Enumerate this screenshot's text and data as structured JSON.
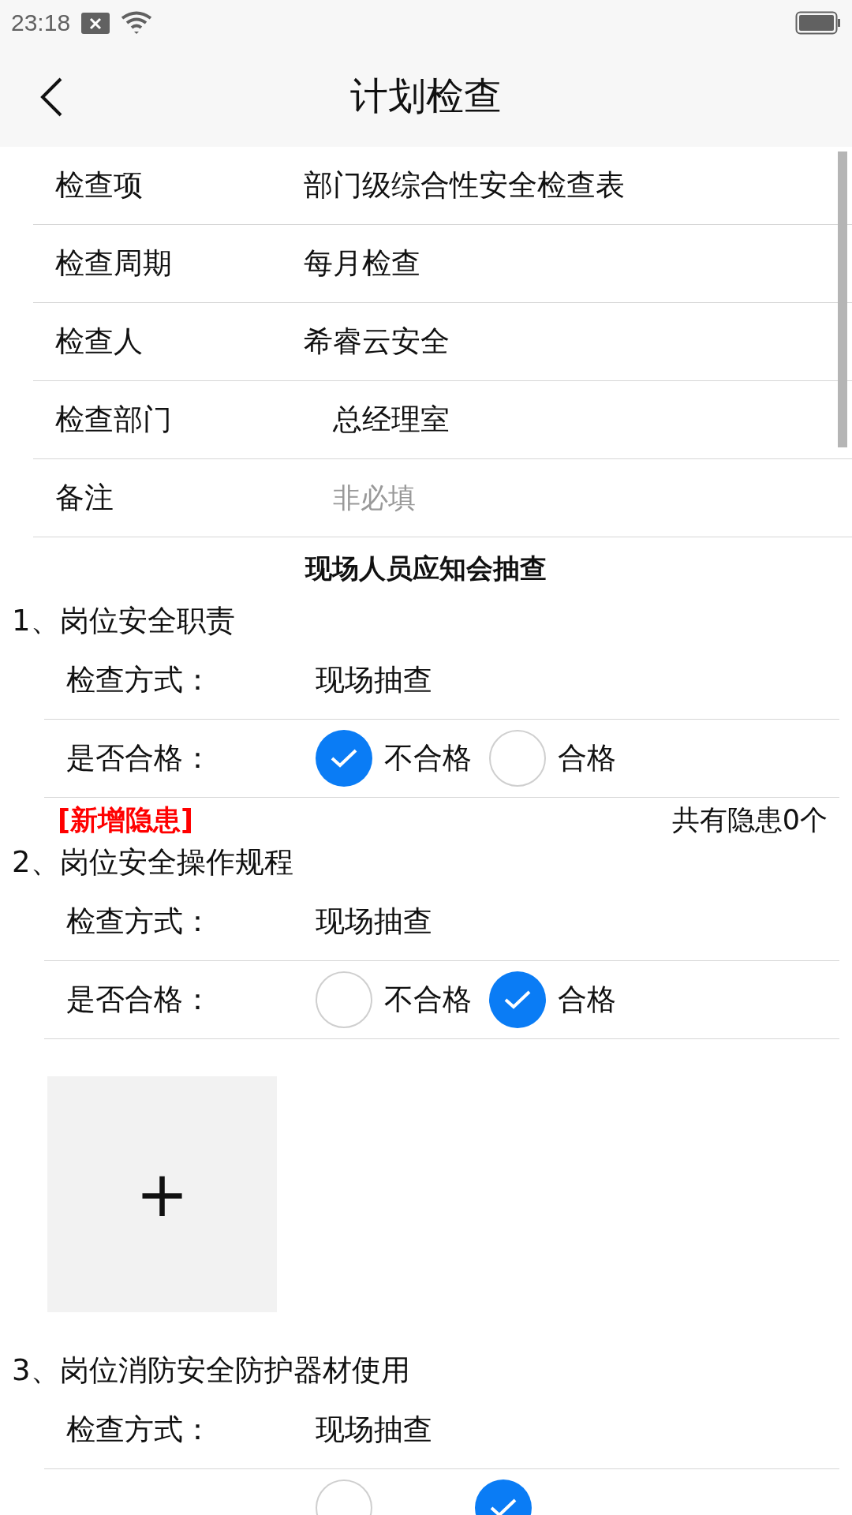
{
  "status_bar": {
    "time": "23:18"
  },
  "header": {
    "title": "计划检查"
  },
  "form": [
    {
      "kind": "text",
      "label": "检查项",
      "value": "部门级综合性安全检查表"
    },
    {
      "kind": "text",
      "label": "检查周期",
      "value": "每月检查"
    },
    {
      "kind": "text",
      "label": "检查人",
      "value": "希睿云安全"
    },
    {
      "kind": "select",
      "label": "检查部门",
      "value": "总经理室"
    },
    {
      "kind": "input",
      "label": "备注",
      "placeholder": "非必填"
    }
  ],
  "section_title": "现场人员应知会抽查",
  "items": [
    {
      "title": "1、岗位安全职责",
      "method_label": "检查方式：",
      "method": "现场抽查",
      "pass_label": "是否合格：",
      "options": [
        {
          "label": "不合格",
          "selected": true
        },
        {
          "label": "合格",
          "selected": false
        }
      ],
      "hazard": {
        "link": "[新增隐患]",
        "count": "共有隐患0个"
      }
    },
    {
      "title": "2、岗位安全操作规程",
      "method_label": "检查方式：",
      "method": "现场抽查",
      "pass_label": "是否合格：",
      "options": [
        {
          "label": "不合格",
          "selected": false
        },
        {
          "label": "合格",
          "selected": true
        }
      ],
      "photo_upload": {
        "button": "+"
      }
    },
    {
      "title": "3、岗位消防安全防护器材使用",
      "method_label": "检查方式：",
      "method": "现场抽查",
      "options": [
        {
          "selected": false
        },
        {
          "selected": true
        }
      ]
    }
  ]
}
